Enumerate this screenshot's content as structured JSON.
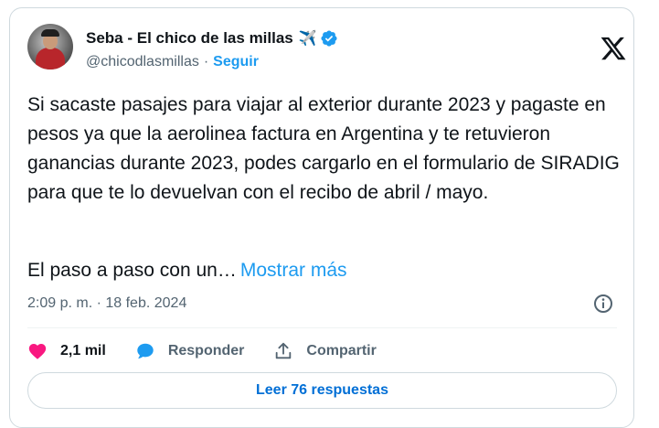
{
  "author": {
    "name": "Seba - El chico de las millas",
    "name_emoji": "✈️",
    "handle": "@chicodlasmillas",
    "separator": "·",
    "follow_label": "Seguir"
  },
  "tweet": {
    "text": "Si sacaste pasajes para viajar al exterior durante 2023 y pagaste en pesos ya que la aerolinea factura en Argentina y te retuvieron ganancias durante 2023, podes cargarlo en el formulario de SIRADIG para que te lo devuelvan con el recibo de abril / mayo.",
    "truncated_text": "El paso a paso con un…",
    "show_more_label": "Mostrar más",
    "timestamp": "2:09 p. m. · 18 feb. 2024"
  },
  "actions": {
    "likes": "2,1 mil",
    "reply_label": "Responder",
    "share_label": "Compartir"
  },
  "replies_button": "Leer 76 respuestas",
  "colors": {
    "accent": "#1d9bf0",
    "like": "#f91880",
    "text": "#0f1419",
    "muted": "#536471",
    "border": "#cfd9de"
  },
  "icons": {
    "verified": "verified-badge-icon",
    "x_logo": "x-logo-icon",
    "info": "info-icon",
    "like": "heart-icon",
    "reply": "speech-bubble-icon",
    "share": "share-upload-icon"
  }
}
